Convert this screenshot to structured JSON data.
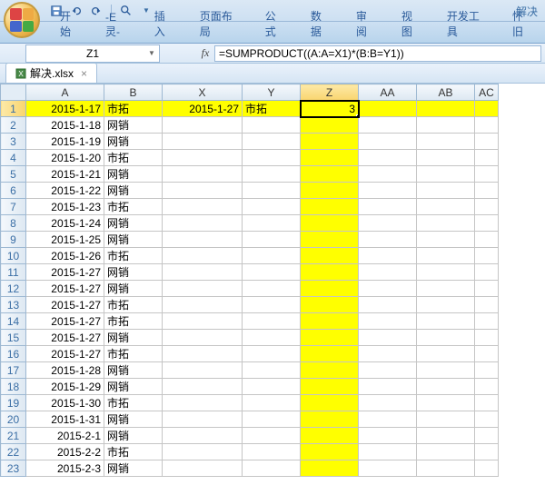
{
  "title": "解决",
  "qat": {
    "save": "保存",
    "undo": "撤销",
    "redo": "重做",
    "print": "打印"
  },
  "ribbon": {
    "tabs": [
      "开始",
      "-E灵-",
      "插入",
      "页面布局",
      "公式",
      "数据",
      "审阅",
      "视图",
      "开发工具",
      "怀旧"
    ]
  },
  "name_box": "Z1",
  "fx_label": "fx",
  "formula": "=SUMPRODUCT((A:A=X1)*(B:B=Y1))",
  "file_tab": {
    "name": "解决.xlsx",
    "close": "×"
  },
  "columns": [
    "A",
    "B",
    "X",
    "Y",
    "Z",
    "AA",
    "AB",
    "AC"
  ],
  "active_col_index": 4,
  "rows": [
    {
      "n": 1,
      "A": "2015-1-17",
      "B": "市拓",
      "X": "2015-1-27",
      "Y": "市拓",
      "Z": "3",
      "hl": true
    },
    {
      "n": 2,
      "A": "2015-1-18",
      "B": "网销"
    },
    {
      "n": 3,
      "A": "2015-1-19",
      "B": "网销"
    },
    {
      "n": 4,
      "A": "2015-1-20",
      "B": "市拓"
    },
    {
      "n": 5,
      "A": "2015-1-21",
      "B": "网销"
    },
    {
      "n": 6,
      "A": "2015-1-22",
      "B": "网销"
    },
    {
      "n": 7,
      "A": "2015-1-23",
      "B": "市拓"
    },
    {
      "n": 8,
      "A": "2015-1-24",
      "B": "网销"
    },
    {
      "n": 9,
      "A": "2015-1-25",
      "B": "网销"
    },
    {
      "n": 10,
      "A": "2015-1-26",
      "B": "市拓"
    },
    {
      "n": 11,
      "A": "2015-1-27",
      "B": "网销"
    },
    {
      "n": 12,
      "A": "2015-1-27",
      "B": "网销"
    },
    {
      "n": 13,
      "A": "2015-1-27",
      "B": "市拓"
    },
    {
      "n": 14,
      "A": "2015-1-27",
      "B": "市拓"
    },
    {
      "n": 15,
      "A": "2015-1-27",
      "B": "网销"
    },
    {
      "n": 16,
      "A": "2015-1-27",
      "B": "市拓"
    },
    {
      "n": 17,
      "A": "2015-1-28",
      "B": "网销"
    },
    {
      "n": 18,
      "A": "2015-1-29",
      "B": "网销"
    },
    {
      "n": 19,
      "A": "2015-1-30",
      "B": "市拓"
    },
    {
      "n": 20,
      "A": "2015-1-31",
      "B": "网销"
    },
    {
      "n": 21,
      "A": "2015-2-1",
      "B": "网销"
    },
    {
      "n": 22,
      "A": "2015-2-2",
      "B": "市拓"
    },
    {
      "n": 23,
      "A": "2015-2-3",
      "B": "网销"
    }
  ]
}
